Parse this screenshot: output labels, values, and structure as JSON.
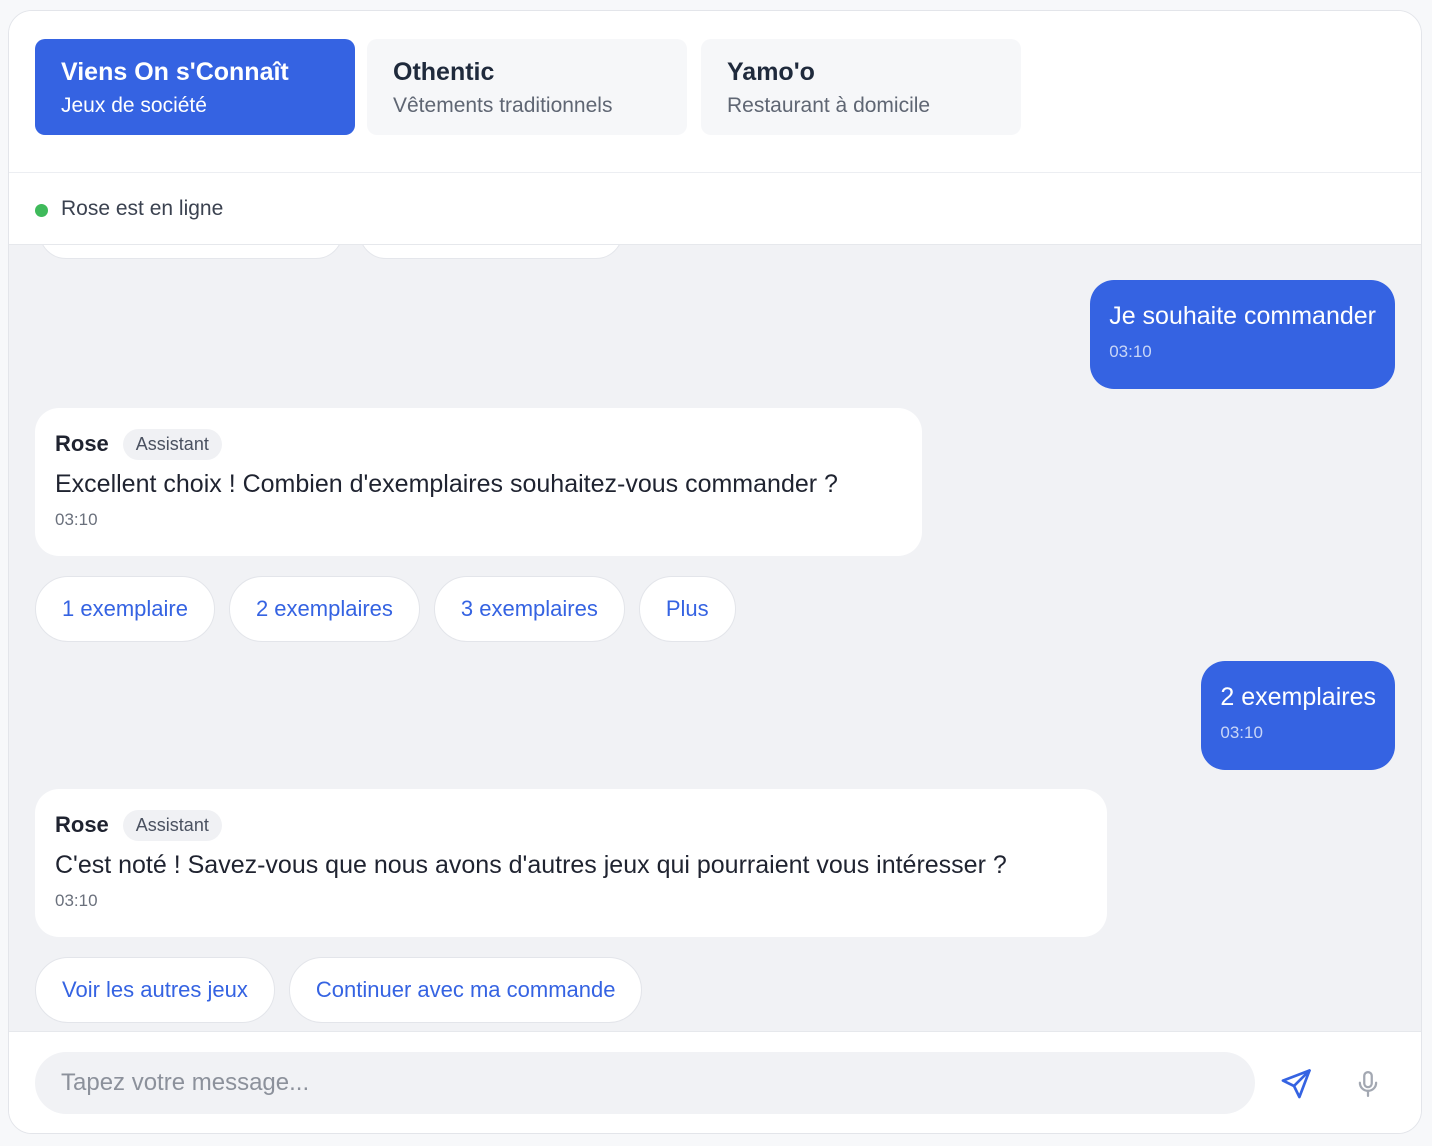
{
  "tabs": [
    {
      "name": "Viens On s'Connaît",
      "subtitle": "Jeux de société",
      "active": true
    },
    {
      "name": "Othentic",
      "subtitle": "Vêtements traditionnels",
      "active": false
    },
    {
      "name": "Yamo'o",
      "subtitle": "Restaurant à domicile",
      "active": false
    }
  ],
  "status": {
    "text": "Rose est en ligne",
    "dot_color": "#3fba5b"
  },
  "messages": [
    {
      "from": "user",
      "text": "Je souhaite commander",
      "time": "03:10"
    },
    {
      "from": "bot",
      "sender": "Rose",
      "role": "Assistant",
      "text": "Excellent choix ! Combien d'exemplaires souhaitez-vous commander ?",
      "time": "03:10",
      "quick_replies": [
        "1 exemplaire",
        "2 exemplaires",
        "3 exemplaires",
        "Plus"
      ]
    },
    {
      "from": "user",
      "text": "2 exemplaires",
      "time": "03:10"
    },
    {
      "from": "bot",
      "sender": "Rose",
      "role": "Assistant",
      "text": "C'est noté ! Savez-vous que nous avons d'autres jeux qui pourraient vous intéresser ?",
      "time": "03:10",
      "quick_replies": [
        "Voir les autres jeux",
        "Continuer avec ma commande"
      ]
    }
  ],
  "composer": {
    "placeholder": "Tapez votre message...",
    "send_icon": "send-icon",
    "mic_icon": "microphone-icon"
  },
  "colors": {
    "accent": "#3563e2",
    "online": "#3fba5b",
    "background": "#f1f2f5"
  }
}
